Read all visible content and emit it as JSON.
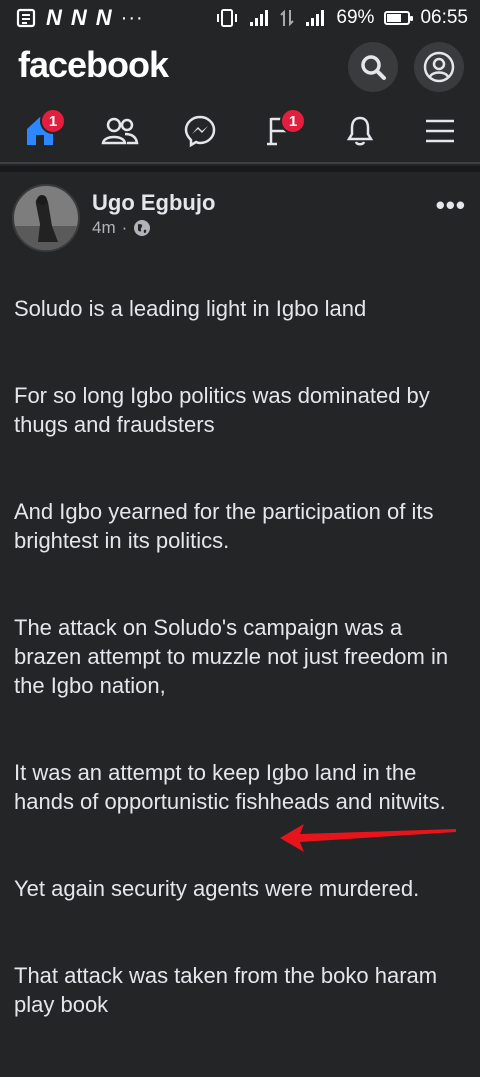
{
  "status_bar": {
    "left_icons": [
      "N",
      "N",
      "N"
    ],
    "dots": "···",
    "battery": "69%",
    "battery_level": 0.69,
    "time": "06:55"
  },
  "header": {
    "logo": "facebook",
    "icons": [
      "search-icon",
      "profile-icon"
    ]
  },
  "tabs": [
    {
      "name": "home",
      "icon": "home-icon",
      "badge": "1",
      "active": true
    },
    {
      "name": "friends",
      "icon": "friends-icon"
    },
    {
      "name": "messenger",
      "icon": "messenger-icon"
    },
    {
      "name": "groups",
      "icon": "flag-icon",
      "badge": "1"
    },
    {
      "name": "notifications",
      "icon": "bell-icon"
    },
    {
      "name": "menu",
      "icon": "menu-icon"
    }
  ],
  "post": {
    "author": "Ugo Egbujo",
    "time": "4m",
    "separator": "·",
    "more": "•••",
    "paragraphs": [
      "Soludo is a leading light in Igbo land",
      "For so long Igbo politics was dominated by thugs and fraudsters",
      "And Igbo yearned for the participation of its brightest in its politics.",
      "The attack on Soludo's campaign was a brazen  attempt to muzzle not just freedom in the Igbo nation,",
      "It was an attempt to keep Igbo land in the hands of opportunistic  fishheads and nitwits.",
      "Yet again security agents were murdered.",
      "That attack was taken from the boko haram play book"
    ]
  },
  "colors": {
    "background": "#242526",
    "accent": "#2d88ff",
    "badge": "#e41e3f",
    "arrow": "#e8141b"
  }
}
